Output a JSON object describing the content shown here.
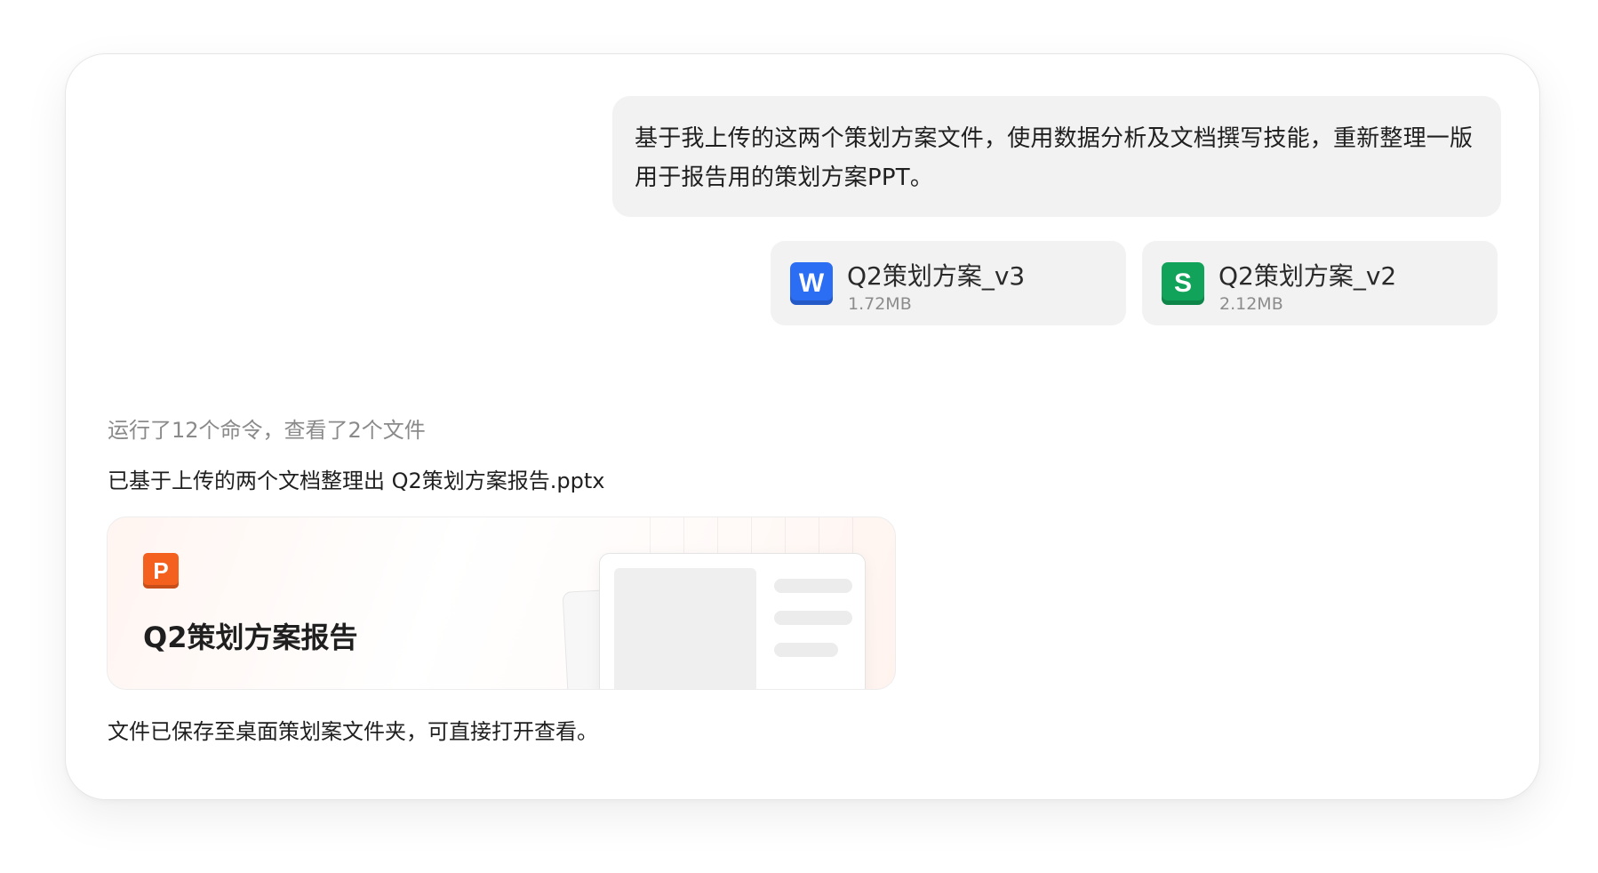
{
  "user_message": {
    "text": "基于我上传的这两个策划方案文件，使用数据分析及文档撰写技能，重新整理一版用于报告用的策划方案PPT。"
  },
  "attachments": [
    {
      "icon": "word-doc-icon",
      "icon_letter": "W",
      "name": "Q2策划方案_v3",
      "size": "1.72MB",
      "color": "#2b6ef3"
    },
    {
      "icon": "spreadsheet-icon",
      "icon_letter": "S",
      "name": "Q2策划方案_v2",
      "size": "2.12MB",
      "color": "#12a35a"
    }
  ],
  "assistant": {
    "status": "运行了12个命令，查看了2个文件",
    "reply": "已基于上传的两个文档整理出 Q2策划方案报告.pptx",
    "output_file": {
      "icon": "powerpoint-icon",
      "icon_letter": "P",
      "title": "Q2策划方案报告",
      "color": "#f4611f"
    },
    "footer": "文件已保存至桌面策划案文件夹，可直接打开查看。"
  }
}
